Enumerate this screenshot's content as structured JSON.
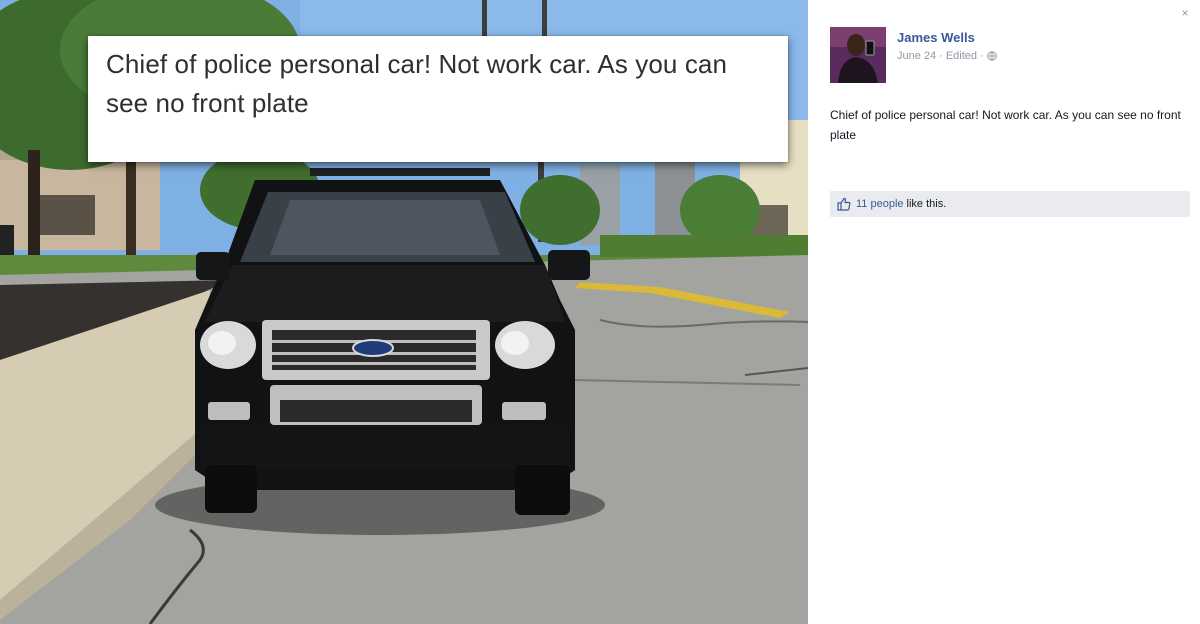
{
  "photo": {
    "caption": "Chief of police personal car! Not work car. As you can see no front plate",
    "grille_badge": "Ford"
  },
  "post": {
    "author": "James Wells",
    "date": "June 24",
    "edited": "Edited",
    "separator": "·",
    "text": "Chief of police personal car! Not work car. As you can see no front plate",
    "likes_count_text": "11 people",
    "likes_suffix": "like this.",
    "close_label": "×"
  },
  "colors": {
    "link": "#3b5998",
    "meta": "#9197a3",
    "likes_bg": "#e9ebee"
  },
  "icons": [
    "close-icon",
    "globe-icon",
    "thumbs-up-icon",
    "avatar-photo"
  ]
}
